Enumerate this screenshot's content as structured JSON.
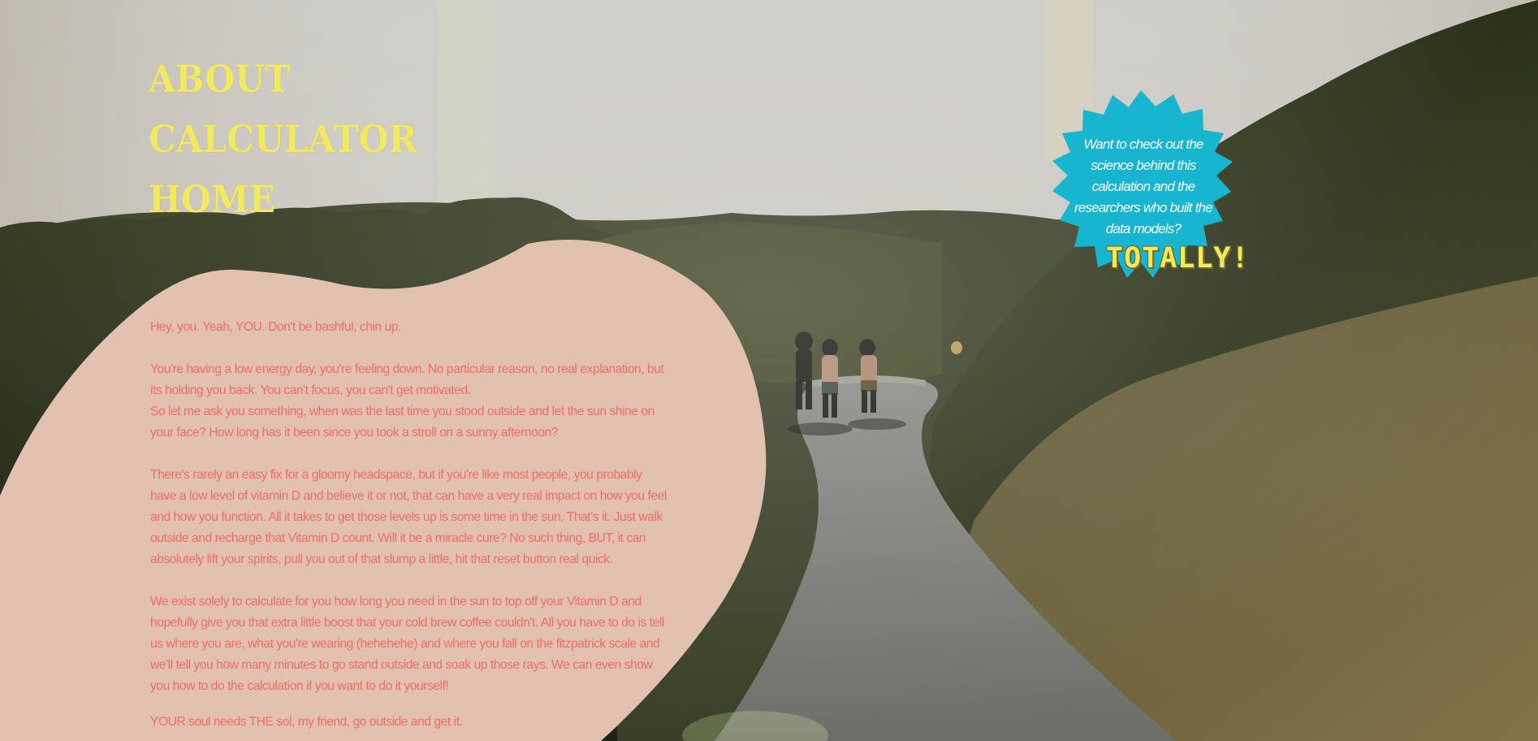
{
  "nav": {
    "items": [
      {
        "label": "ABOUT"
      },
      {
        "label": "CALCULATOR"
      },
      {
        "label": "HOME"
      }
    ]
  },
  "intro": {
    "p1": "Hey, you. Yeah, YOU. Don't be bashful, chin up.",
    "p2": "You're having a low energy day, you're feeling down. No particular reason, no real explanation, but its holding you back. You can't focus, you can't get motivated.",
    "p3": "So let me ask you something, when was the last time you stood outside and let the sun shine on your face? How long has it been since you took a stroll on a sunny afternoon?",
    "p4": "There's rarely an easy fix for a gloomy headspace, but if you're like most people, you probably have a low level of vitamin D and believe it or not, that can have a very real impact on how you feel and how you function. All it takes to get those levels up is some time in the sun. That's it. Just walk outside and recharge that Vitamin D count. Will it be a miracle cure? No such thing, BUT, it can absolutely lift your spirits, pull you out of that slump a little, hit that reset button real quick.",
    "p5": "We exist solely to calculate for you how long you need in the sun to top off your Vitamin D and hopefully give you that extra little boost that your cold brew coffee couldn't. All you have to do is tell us where you are, what you're wearing (hehehehe) and where you fall on the fitzpatrick scale and we'll tell you how many minutes to go stand outside and soak up those rays. We can even show you how to do the calculation if you want to do it yourself!",
    "p6": "YOUR soul needs THE sol, my friend, go outside and get it."
  },
  "callout": {
    "text": "Want to check out the science behind this calculation and the researchers who built the data models?",
    "button": "TOTALLY!"
  },
  "colors": {
    "nav_yellow": "#f3e862",
    "blob_pink": "#e3c1b1",
    "copy_coral": "#ef6d68",
    "burst_blue": "#17b5cf"
  },
  "icons": {
    "callout_shape": "starburst"
  }
}
